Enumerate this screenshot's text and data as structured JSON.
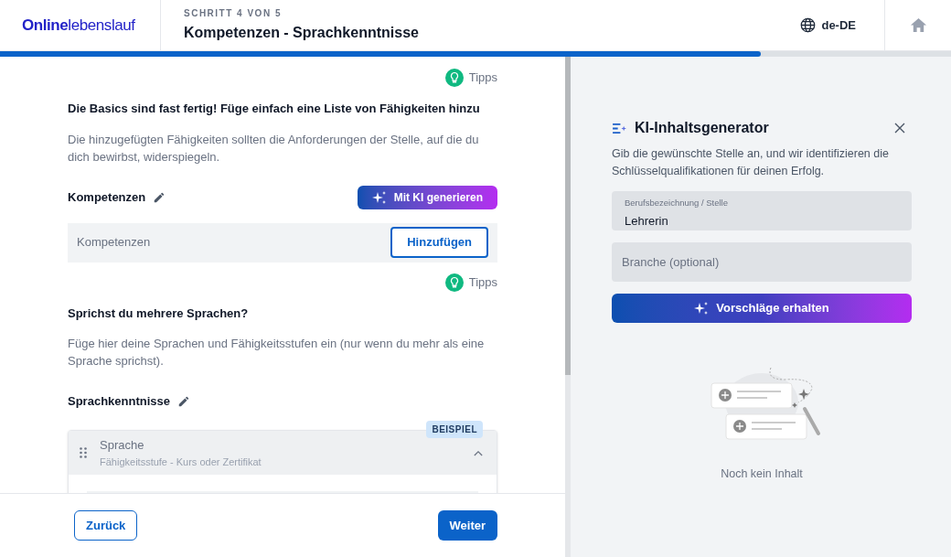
{
  "header": {
    "logo": "**Online**lebenslauf",
    "step": "SCHRITT 4 VON 5",
    "title": "Kompetenzen - Sprachkenntnisse",
    "language": "de-DE"
  },
  "progress": {
    "level": 0.8
  },
  "sections": [
    {
      "tips": "Tipps",
      "heading": "Die Basics sind fast fertig! Füge einfach eine Liste von Fähigkeiten hinzu",
      "description": "Die hinzugefügten Fähigkeiten sollten die Anforderungen der Stelle, auf die du dich bewirbst, widerspiegeln.",
      "label": "Kompetenzen",
      "kind": "skills",
      "ai_button": "Mit KI generieren",
      "input": {
        "placeholder": "Kompetenzen"
      },
      "add_button": "Hinzufügen"
    },
    {
      "tips": "Tipps",
      "heading": "Sprichst du mehrere Sprachen?",
      "description": "Füge hier deine Sprachen und Fähigkeitsstufen ein (nur wenn du mehr als eine Sprache sprichst).",
      "label": "Sprachkenntnisse",
      "kind": "languages",
      "card": {
        "badge": "BEISPIEL",
        "title": "Sprache",
        "subtitle": "Fähigkeitsstufe - Kurs oder Zertifikat",
        "expanded": true
      }
    }
  ],
  "footer": {
    "back": "Zurück",
    "next": "Weiter"
  },
  "ai_panel": {
    "title": "KI-Inhaltsgenerator",
    "description": "Gib die gewünschte Stelle an, und wir identifizieren die Schlüsselqualifikationen für deinen Erfolg.",
    "fields": [
      {
        "label": "Berufsbezeichnung / Stelle",
        "value": "Lehrerin"
      },
      {
        "placeholder": "Branche (optional)"
      }
    ],
    "button": "Vorschläge erhalten",
    "empty_text": "Noch kein Inhalt"
  }
}
